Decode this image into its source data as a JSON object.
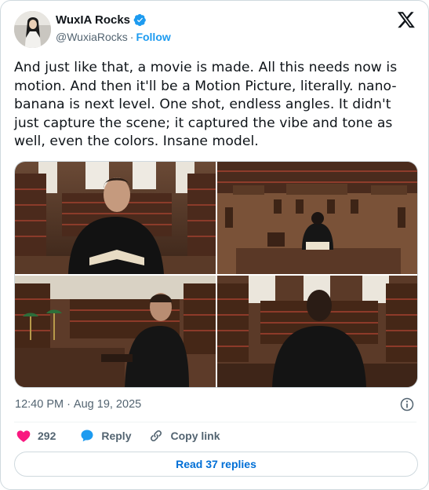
{
  "author": {
    "display_name": "WuxIA Rocks",
    "handle": "@WuxiaRocks",
    "separator": "·",
    "follow_label": "Follow",
    "verified": true
  },
  "tweet": {
    "text": "And just like that, a movie is made. All this needs now is motion. And then it'll be a Motion Picture, literally. nano-banana is next level. One shot, endless angles. It didn't just capture the scene; it captured the vibe and tone as well, even the colors. Insane model.",
    "media_count": 4
  },
  "meta": {
    "time": "12:40 PM",
    "separator": "·",
    "date": "Aug 19, 2025"
  },
  "actions": {
    "like_count": "292",
    "reply_label": "Reply",
    "copy_link_label": "Copy link",
    "read_replies_label": "Read 37 replies"
  },
  "colors": {
    "accent": "#1d9bf0",
    "like": "#f91880",
    "reply_link": "#006fd6",
    "secondary_text": "#536471",
    "border": "#cfd9de"
  },
  "icons": {
    "verified": "verified-badge-icon",
    "logo": "x-logo-icon",
    "info": "info-icon",
    "like": "heart-icon",
    "reply": "speech-bubble-icon",
    "copy_link": "link-icon"
  }
}
